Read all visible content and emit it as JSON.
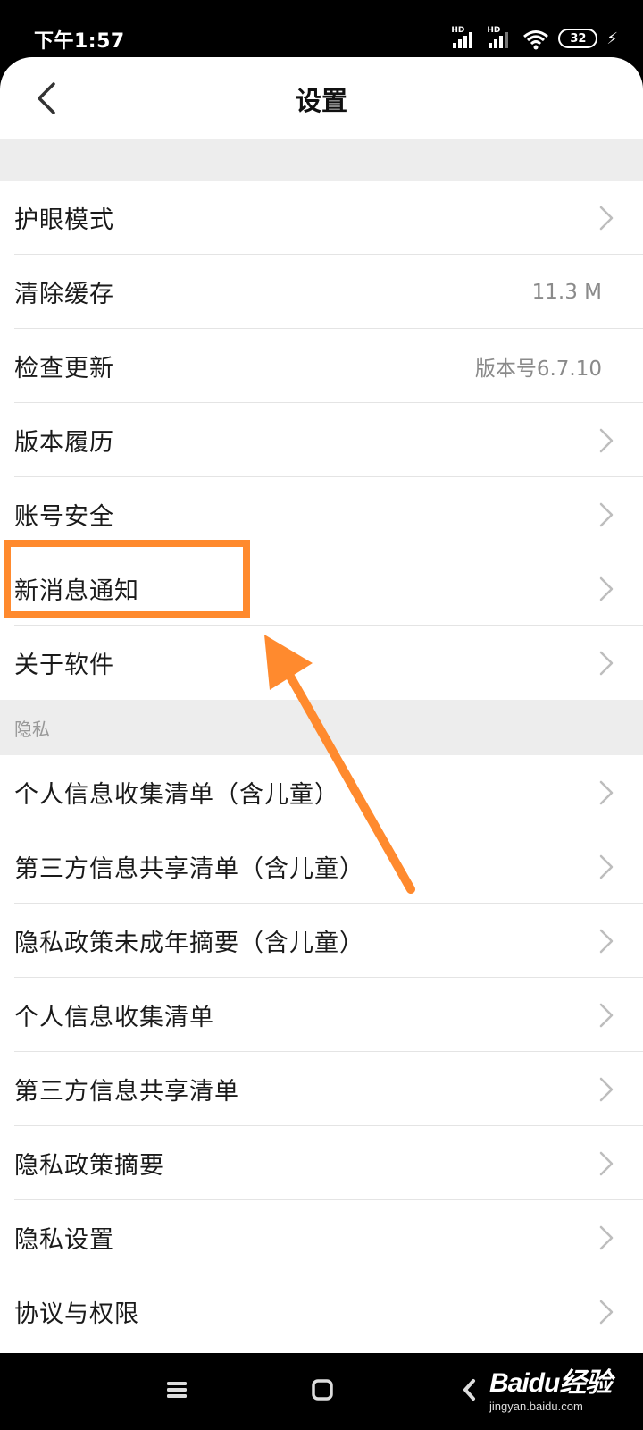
{
  "status_bar": {
    "time": "下午1:57",
    "network_1": "HD",
    "network_2": "HD",
    "battery": "32",
    "icons": [
      "signal-icon",
      "signal-icon",
      "wifi-icon",
      "battery-icon",
      "charging-icon"
    ]
  },
  "header": {
    "title": "设置",
    "back_icon": "chevron-left-icon"
  },
  "settings": [
    {
      "label": "护眼模式",
      "value": ""
    },
    {
      "label": "清除缓存",
      "value": "11.3 M"
    },
    {
      "label": "检查更新",
      "value": "版本号6.7.10"
    },
    {
      "label": "版本履历",
      "value": ""
    },
    {
      "label": "账号安全",
      "value": ""
    },
    {
      "label": "新消息通知",
      "value": ""
    },
    {
      "label": "关于软件",
      "value": ""
    }
  ],
  "privacy": {
    "section_label": "隐私",
    "items": [
      {
        "label": "个人信息收集清单（含儿童）"
      },
      {
        "label": "第三方信息共享清单（含儿童）"
      },
      {
        "label": "隐私政策未成年摘要（含儿童）"
      },
      {
        "label": "个人信息收集清单"
      },
      {
        "label": "第三方信息共享清单"
      },
      {
        "label": "隐私政策摘要"
      },
      {
        "label": "隐私设置"
      },
      {
        "label": "协议与权限"
      }
    ]
  },
  "annotation": {
    "color": "#ff8a2e",
    "highlighted_item": "新消息通知"
  },
  "nav_bar": {
    "icons": [
      "menu-icon",
      "home-icon",
      "back-icon"
    ]
  },
  "watermark": {
    "logo": "Baidu经验",
    "url": "jingyan.baidu.com"
  }
}
